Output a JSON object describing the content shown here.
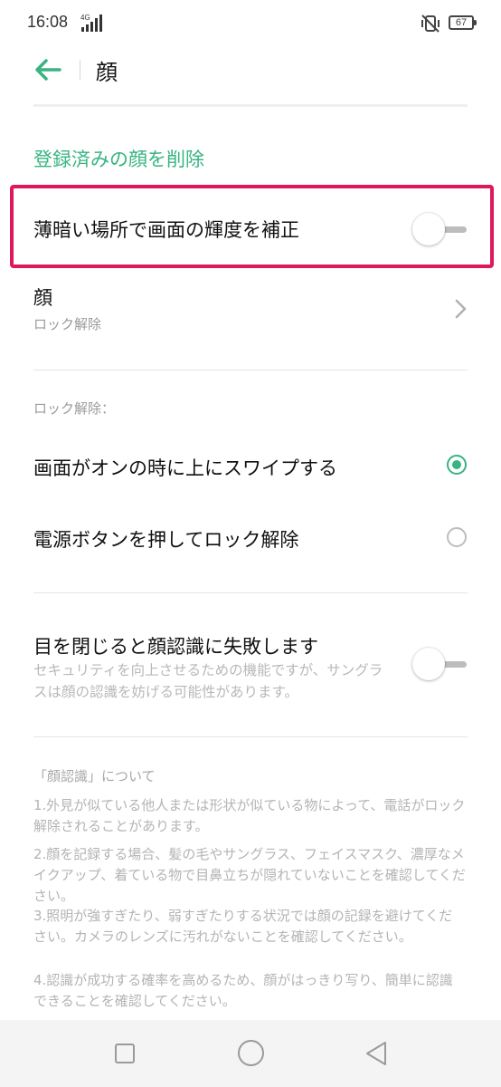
{
  "status_bar": {
    "time": "16:08",
    "network": "4G",
    "battery": "67"
  },
  "header": {
    "title": "顔",
    "back_icon": "arrow-left-icon"
  },
  "actions": {
    "delete_face": "登録済みの顔を削除"
  },
  "settings": {
    "dim_brightness": {
      "label": "薄暗い場所で画面の輝度を補正",
      "enabled": false
    },
    "face": {
      "title": "顔",
      "subtitle": "ロック解除"
    },
    "unlock_section": {
      "label": "ロック解除：",
      "options": [
        {
          "label": "画面がオンの時に上にスワイプする",
          "selected": true
        },
        {
          "label": "電源ボタンを押してロック解除",
          "selected": false
        }
      ]
    },
    "eyes_closed": {
      "title": "目を閉じると顔認識に失敗します",
      "description": "セキュリティを向上させるための機能ですが、サングラスは顔の認識を妨げる可能性があります。",
      "enabled": false
    }
  },
  "about": {
    "title": "「顔認識」について",
    "paragraphs": [
      "1.外見が似ている他人または形状が似ている物によって、電話がロック解除されることがあります。",
      "2.顔を記録する場合、髪の毛やサングラス、フェイスマスク、濃厚なメイクアップ、着ている物で目鼻立ちが隠れていないことを確認してください。",
      "3.照明が強すぎたり、弱すぎたりする状況では顔の記録を避けてください。カメラのレンズに汚れがないことを確認してください。",
      "4.認識が成功する確率を高めるため、顔がはっきり写り、簡単に認識できることを確認してください。"
    ]
  },
  "colors": {
    "accent": "#37b482",
    "highlight": "#e0185a"
  }
}
